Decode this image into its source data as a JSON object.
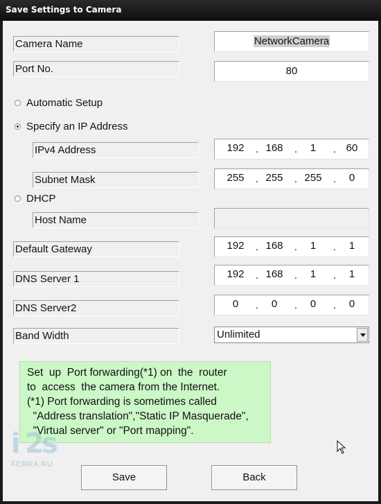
{
  "window": {
    "title": "Save Settings to Camera"
  },
  "fields": {
    "camera_name": {
      "label": "Camera Name",
      "value": "NetworkCamera"
    },
    "port": {
      "label": "Port No.",
      "value": "80"
    }
  },
  "setup": {
    "automatic_label": "Automatic Setup",
    "specify_ip_label": "Specify an IP Address",
    "dhcp_label": "DHCP",
    "selected": "Specify an IP Address"
  },
  "ipv4": {
    "label": "IPv4 Address",
    "octets": [
      "192",
      "168",
      "1",
      "60"
    ]
  },
  "subnet": {
    "label": "Subnet Mask",
    "octets": [
      "255",
      "255",
      "255",
      "0"
    ]
  },
  "host_name": {
    "label": "Host Name",
    "value": ""
  },
  "gateway": {
    "label": "Default Gateway",
    "octets": [
      "192",
      "168",
      "1",
      "1"
    ]
  },
  "dns1": {
    "label": "DNS Server 1",
    "octets": [
      "192",
      "168",
      "1",
      "1"
    ]
  },
  "dns2": {
    "label": "DNS Server2",
    "octets": [
      "0",
      "0",
      "0",
      "0"
    ]
  },
  "bandwidth": {
    "label": "Band Width",
    "value": "Unlimited"
  },
  "note": {
    "lines": [
      "Set  up  Port forwarding(*1) on  the  router",
      "to  access  the camera from the Internet.",
      "(*1) Port forwarding is sometimes called",
      "  \"Address translation\",\"Static IP Masquerade\",",
      "  \"Virtual server\" or \"Port mapping\"."
    ],
    "background": "#ccf7c6"
  },
  "buttons": {
    "save": "Save",
    "back": "Back"
  },
  "watermark": {
    "text": "FERRA.RU"
  }
}
